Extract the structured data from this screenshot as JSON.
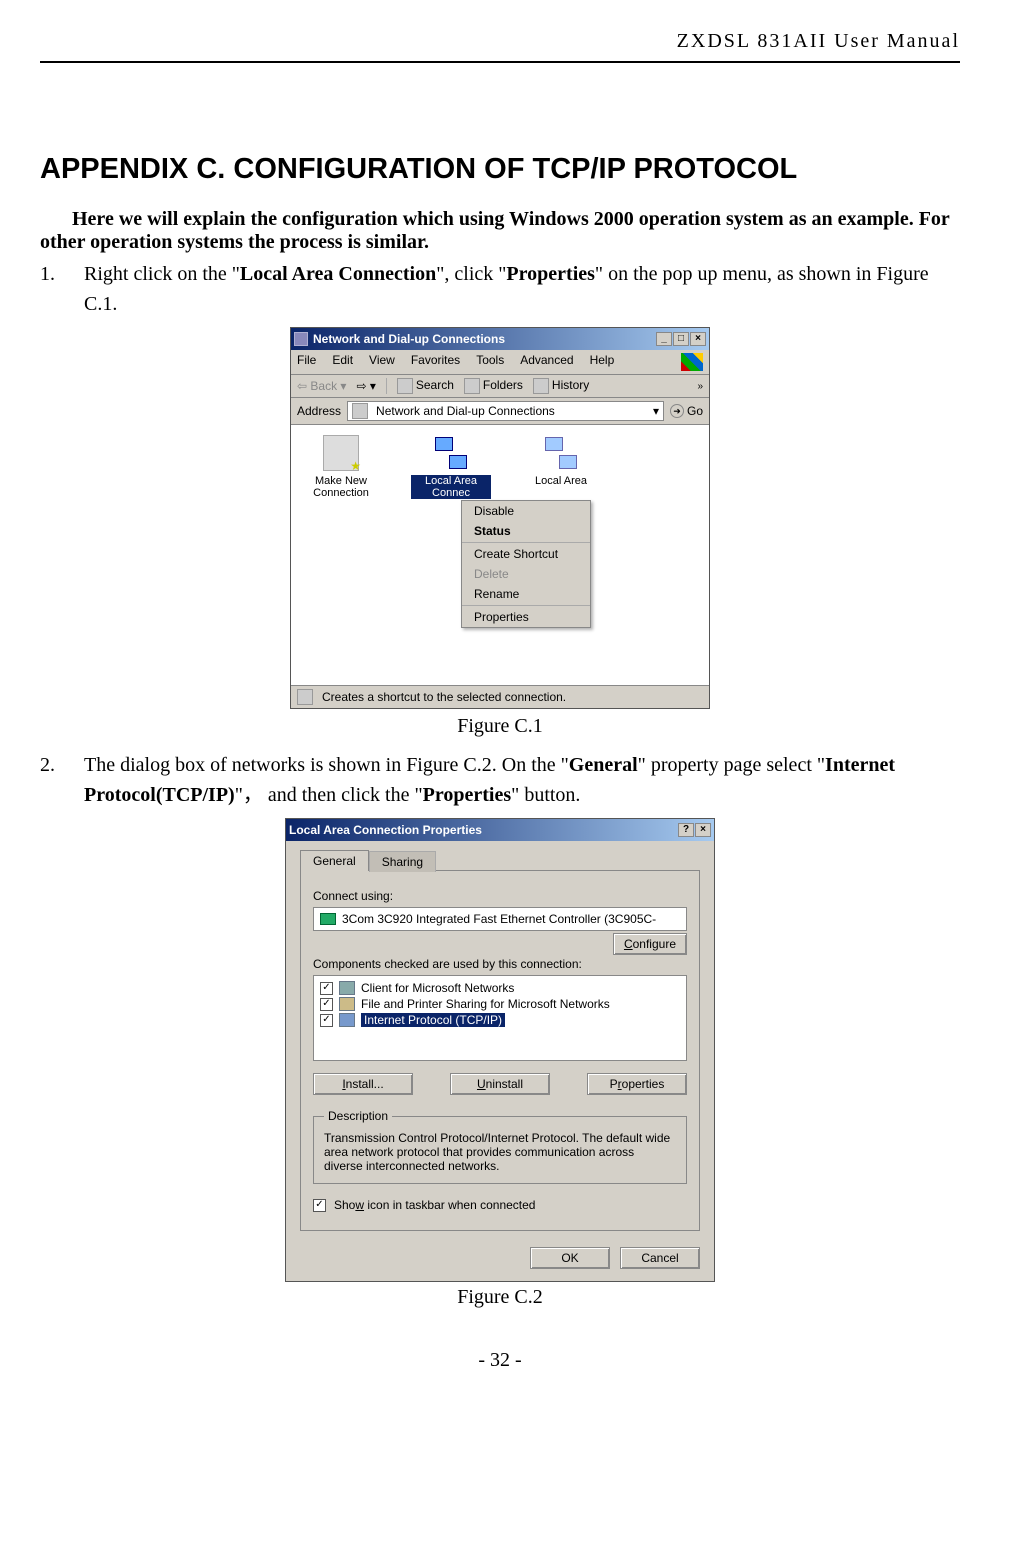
{
  "doc_header": "ZXDSL 831AII User Manual",
  "heading": "APPENDIX C. CONFIGURATION OF TCP/IP PROTOCOL",
  "intro_pre": "Here we will explain the configuration which using Windows 2000 operation system as an example. For other operation systems the process is similar.",
  "step1": {
    "num": "1.",
    "t1": "Right click on the \"",
    "b1": "Local Area Connection",
    "t2": "\", click \"",
    "b2": "Properties",
    "t3": "\" on the pop up menu, as shown in Figure C.1."
  },
  "fig1_caption": "Figure C.1",
  "step2": {
    "num": "2.",
    "t1": "The dialog box of networks is shown in Figure C.2. On the \"",
    "b1": "General",
    "t2": "\" property page select \"",
    "b2": "Internet Protocol(TCP/IP)",
    "t3": "\"， and then click the \"",
    "b3": "Properties",
    "t4": "\" button."
  },
  "fig2_caption": "Figure C.2",
  "page_num": "- 32 -",
  "win1": {
    "title": "Network and Dial-up Connections",
    "menus": [
      "File",
      "Edit",
      "View",
      "Favorites",
      "Tools",
      "Advanced",
      "Help"
    ],
    "toolbar": {
      "back": "Back",
      "search": "Search",
      "folders": "Folders",
      "history": "History"
    },
    "address_label": "Address",
    "address_value": "Network and Dial-up Connections",
    "go": "Go",
    "icons": {
      "makenew": "Make New Connection",
      "lac_sel": "Local Area Connec",
      "lac2": "Local Area"
    },
    "ctx": {
      "disable": "Disable",
      "status": "Status",
      "shortcut": "Create Shortcut",
      "delete": "Delete",
      "rename": "Rename",
      "properties": "Properties"
    },
    "status": "Creates a shortcut to the selected connection."
  },
  "dlg": {
    "title": "Local Area Connection Properties",
    "tab_general": "General",
    "tab_sharing": "Sharing",
    "connect_using": "Connect using:",
    "nic": "3Com 3C920 Integrated Fast Ethernet Controller (3C905C-",
    "configure": "Configure",
    "components_label": "Components checked are used by this connection:",
    "comp1": "Client for Microsoft Networks",
    "comp2": "File and Printer Sharing for Microsoft Networks",
    "comp3": "Internet Protocol (TCP/IP)",
    "install": "Install...",
    "uninstall": "Uninstall",
    "properties": "Properties",
    "desc_legend": "Description",
    "desc_text": "Transmission Control Protocol/Internet Protocol. The default wide area network protocol that provides communication across diverse interconnected networks.",
    "show_icon": "Show icon in taskbar when connected",
    "ok": "OK",
    "cancel": "Cancel"
  }
}
